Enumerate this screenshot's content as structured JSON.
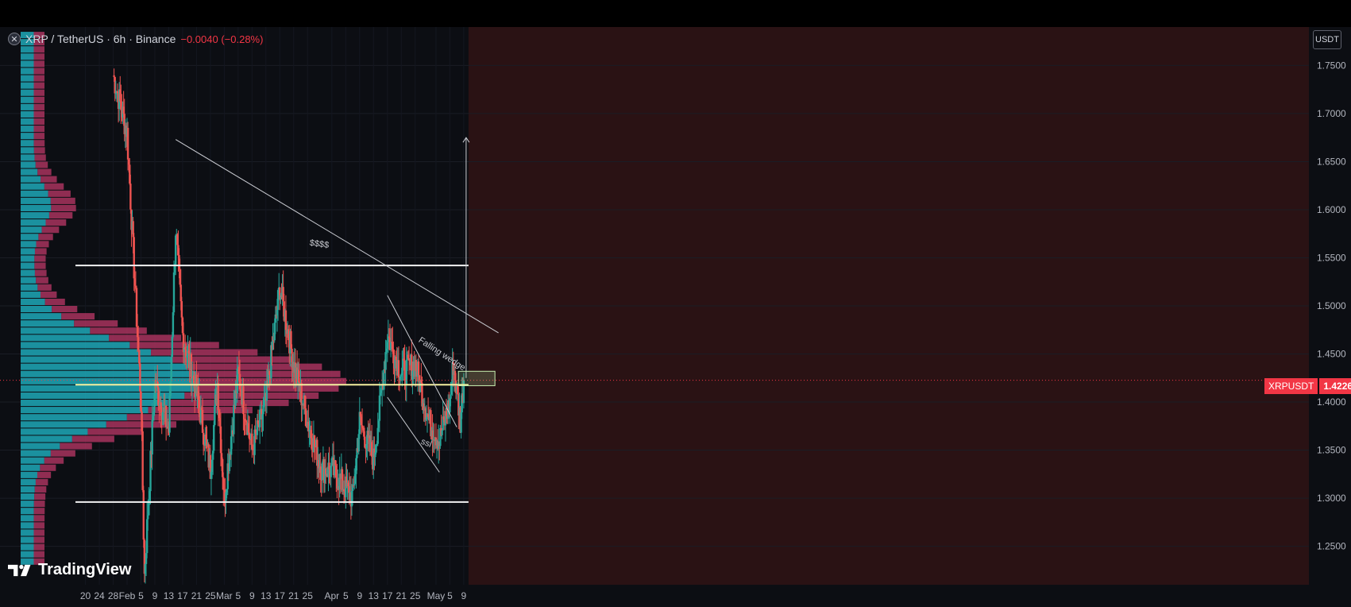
{
  "header": {
    "symbol": "XRP / TetherUS · 6h · Binance",
    "change": "−0.0040 (−0.28%)"
  },
  "currency_label": "USDT",
  "price_tag": {
    "symbol": "XRPUSDT",
    "value": "1.4226"
  },
  "logo_text": "TradingView",
  "colors": {
    "up": "#26a69a",
    "down": "#ef5350",
    "background": "#0c0e13",
    "accent_red": "#f23645",
    "volume_up": "#1fa8b8",
    "volume_down": "#a8325e"
  },
  "chart_data": {
    "type": "candlestick",
    "title": "XRP / TetherUS · 6h · Binance",
    "y_axis": {
      "min": 1.21,
      "max": 1.79,
      "ticks": [
        "1.7500",
        "1.7000",
        "1.6500",
        "1.6000",
        "1.5500",
        "1.5000",
        "1.4500",
        "1.4000",
        "1.3500",
        "1.3000",
        "1.2500"
      ]
    },
    "x_axis_ticks": [
      "20",
      "24",
      "28",
      "Feb",
      "5",
      "9",
      "13",
      "17",
      "21",
      "25",
      "Mar",
      "5",
      "9",
      "13",
      "17",
      "21",
      "25",
      "Apr",
      "5",
      "9",
      "13",
      "17",
      "21",
      "25",
      "May",
      "5",
      "9"
    ],
    "last_price": 1.4226,
    "horizontal_levels": [
      1.542,
      1.418,
      1.296
    ],
    "annotations": [
      "$$$$",
      "Falling wedge",
      "ssl"
    ],
    "trendline_resistance": {
      "from": [
        "Feb 15",
        1.673
      ],
      "to": [
        "May 19",
        1.472
      ]
    },
    "wedge_upper": {
      "from": [
        "Apr 17",
        1.511
      ],
      "to": [
        "May 7",
        1.374
      ]
    },
    "wedge_lower": {
      "from": [
        "Apr 17",
        1.405
      ],
      "to": [
        "May 2",
        1.327
      ]
    },
    "target_arrow": {
      "date": "May 9",
      "from": 1.425,
      "to": 1.675
    },
    "key_points": [
      {
        "x": "Jan 28",
        "close": 1.74
      },
      {
        "x": "Feb 1",
        "close": 1.68
      },
      {
        "x": "Feb 3",
        "close": 1.54
      },
      {
        "x": "Feb 5",
        "close": 1.4
      },
      {
        "x": "Feb 6",
        "close": 1.22
      },
      {
        "x": "Feb 9",
        "close": 1.42
      },
      {
        "x": "Feb 13",
        "close": 1.37
      },
      {
        "x": "Feb 15",
        "close": 1.58
      },
      {
        "x": "Feb 17",
        "close": 1.47
      },
      {
        "x": "Feb 21",
        "close": 1.41
      },
      {
        "x": "Feb 25",
        "close": 1.33
      },
      {
        "x": "Feb 27",
        "close": 1.42
      },
      {
        "x": "Mar 1",
        "close": 1.3
      },
      {
        "x": "Mar 5",
        "close": 1.43
      },
      {
        "x": "Mar 9",
        "close": 1.35
      },
      {
        "x": "Mar 13",
        "close": 1.4
      },
      {
        "x": "Mar 17",
        "close": 1.52
      },
      {
        "x": "Mar 21",
        "close": 1.44
      },
      {
        "x": "Mar 25",
        "close": 1.38
      },
      {
        "x": "Mar 29",
        "close": 1.33
      },
      {
        "x": "Apr 1",
        "close": 1.33
      },
      {
        "x": "Apr 5",
        "close": 1.31
      },
      {
        "x": "Apr 7",
        "close": 1.3
      },
      {
        "x": "Apr 9",
        "close": 1.38
      },
      {
        "x": "Apr 13",
        "close": 1.34
      },
      {
        "x": "Apr 15",
        "close": 1.4
      },
      {
        "x": "Apr 17",
        "close": 1.47
      },
      {
        "x": "Apr 21",
        "close": 1.43
      },
      {
        "x": "Apr 25",
        "close": 1.44
      },
      {
        "x": "Apr 29",
        "close": 1.38
      },
      {
        "x": "May 2",
        "close": 1.36
      },
      {
        "x": "May 5",
        "close": 1.4
      },
      {
        "x": "May 6",
        "close": 1.44
      },
      {
        "x": "May 8",
        "close": 1.38
      },
      {
        "x": "May 9",
        "close": 1.4226
      }
    ]
  }
}
